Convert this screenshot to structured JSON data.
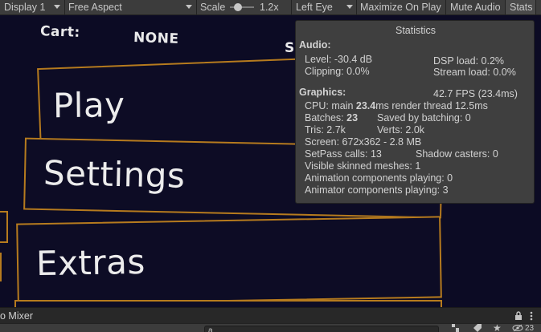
{
  "toolbar": {
    "display": "Display 1",
    "aspect": "Free Aspect",
    "scale_label": "Scale",
    "scale_value": "1.2x",
    "eye": "Left Eye",
    "maximize": "Maximize On Play",
    "mute": "Mute Audio",
    "stats": "Stats"
  },
  "game": {
    "cart_label": "Cart:",
    "cart_value": "NONE",
    "partial_text": "S",
    "menu_buttons": [
      "Play",
      "Settings",
      "Extras"
    ],
    "accent_color": "#b67b1e",
    "background_color": "#0c0b24"
  },
  "stats": {
    "title": "Statistics",
    "audio_header": "Audio:",
    "level": "Level: -30.4 dB",
    "clipping": "Clipping: 0.0%",
    "dsp_load": "DSP load: 0.2%",
    "stream_load": "Stream load: 0.0%",
    "graphics_header": "Graphics:",
    "fps": "42.7 FPS (23.4ms)",
    "cpu_prefix": "CPU: main ",
    "cpu_main": "23.4",
    "cpu_suffix": "ms  render thread 12.5ms",
    "batches_prefix": "Batches: ",
    "batches": "23",
    "saved_batching": "Saved by batching: 0",
    "tris": "Tris: 2.7k",
    "verts": "Verts: 2.0k",
    "screen": "Screen: 672x362 - 2.8 MB",
    "setpass": "SetPass calls: 13",
    "shadow_casters": "Shadow casters: 0",
    "skinned_meshes": "Visible skinned meshes: 1",
    "animation_components": "Animation components playing: 0",
    "animator_components": "Animator components playing: 3"
  },
  "dock": {
    "title": "o Mixer",
    "search_value": "a",
    "lock_icon": "lock-icon",
    "more_icon": "more-vertical-icon",
    "visibility_count": "23"
  }
}
